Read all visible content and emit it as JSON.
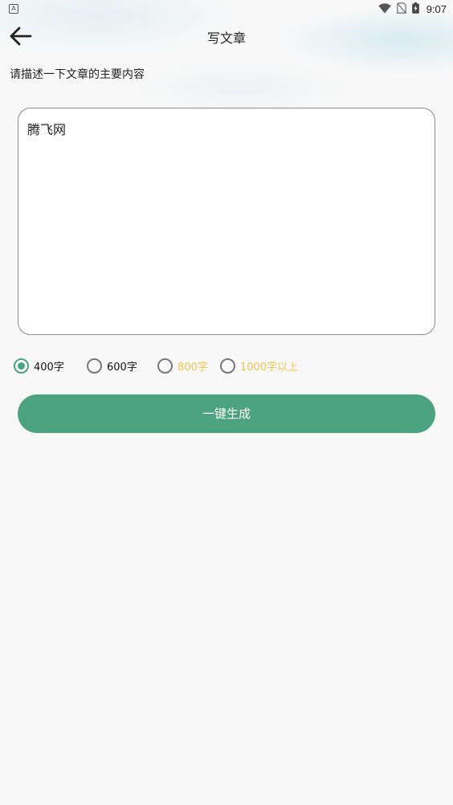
{
  "status_bar": {
    "notification_icon": "A",
    "icons": [
      "wifi-icon",
      "no-sim-icon",
      "battery-icon"
    ],
    "time": "9:07"
  },
  "header": {
    "back_icon": "arrow-left-icon",
    "title": "写文章"
  },
  "prompt": "请描述一下文章的主要内容",
  "input": {
    "value": "腾飞网"
  },
  "word_count_options": [
    {
      "label": "400字",
      "selected": true
    },
    {
      "label": "600字",
      "selected": false
    },
    {
      "label": "800字",
      "selected": false
    },
    {
      "label": "1000字以上",
      "selected": false
    }
  ],
  "generate_button": "一键生成",
  "colors": {
    "accent": "#4ca382",
    "muted_option": "#f6c24a",
    "background": "#f8f8f8"
  }
}
